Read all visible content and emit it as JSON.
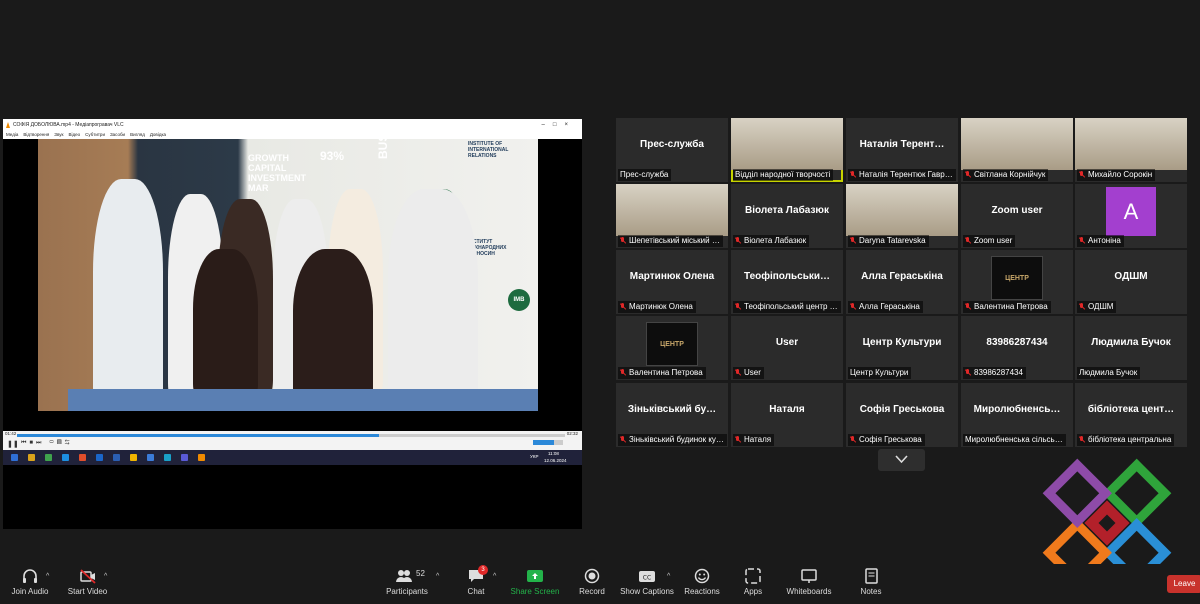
{
  "shared_screen": {
    "vlc_title": "СОФІЯ ДОБОЛЮВА.mp4 - Медіапрогравач VLC",
    "menu": [
      "Медіа",
      "Відтворення",
      "Звук",
      "Відео",
      "Субтитри",
      "Засоби",
      "Вигляд",
      "Довідка"
    ],
    "time_elapsed": "01:42",
    "time_total": "02:32",
    "progress": 0.66,
    "poster_texts": [
      "GROWTH CAPITAL INVESTMENT MAR",
      "93%",
      "BUSINESS",
      "INSTITUTE OF INTERNATIONAL RELATIONS",
      "ІНСТИТУТ МІЖНАРОДНИХ ВІДНОСИН",
      "IMB"
    ],
    "taskbar": {
      "lang": "УКР",
      "time": "11:08",
      "date": "12.06.2024"
    }
  },
  "gallery": {
    "tiles": [
      {
        "big": "Прес-служба",
        "caption": "Прес-служба",
        "muted": false,
        "video": false
      },
      {
        "big": "",
        "caption": "Відділ народної творчості",
        "muted": false,
        "video": true,
        "speaker": true
      },
      {
        "big": "Наталія Терент…",
        "caption": "Наталія Терентюк Гавр…",
        "muted": true,
        "video": false
      },
      {
        "big": "",
        "caption": "Світлана Корнійчук",
        "muted": true,
        "video": true
      },
      {
        "big": "",
        "caption": "Михайло Сорокін",
        "muted": true,
        "video": true
      },
      {
        "big": "",
        "caption": "Шепетівський міський …",
        "muted": true,
        "video": true
      },
      {
        "big": "Віолета Лабазюк",
        "caption": "Віолета Лабазюк",
        "muted": true,
        "video": false
      },
      {
        "big": "",
        "caption": "Daryna Tatarevska",
        "muted": true,
        "video": true
      },
      {
        "big": "Zoom user",
        "caption": "Zoom user",
        "muted": true,
        "video": false
      },
      {
        "big": "A",
        "caption": "Антоніна",
        "muted": true,
        "video": false,
        "avatar": true
      },
      {
        "big": "Мартинюк Олена",
        "caption": "Мартинюк Олена",
        "muted": true,
        "video": false
      },
      {
        "big": "Теофіпольськи…",
        "caption": "Теофіпольський центр …",
        "muted": true,
        "video": false
      },
      {
        "big": "Алла Гераськіна",
        "caption": "Алла Гераськіна",
        "muted": true,
        "video": false
      },
      {
        "big": "",
        "caption": "Валентина Петрова",
        "muted": true,
        "video": false,
        "image": true
      },
      {
        "big": "ОДШМ",
        "caption": "ОДШМ",
        "muted": true,
        "video": false
      },
      {
        "big": "",
        "caption": "Валентина Петрова",
        "muted": true,
        "video": false,
        "image": true
      },
      {
        "big": "User",
        "caption": "User",
        "muted": true,
        "video": false
      },
      {
        "big": "Центр Культури",
        "caption": "Центр Культури",
        "muted": false,
        "video": false
      },
      {
        "big": "83986287434",
        "caption": "83986287434",
        "muted": true,
        "video": false
      },
      {
        "big": "Людмила Бучок",
        "caption": "Людмила Бучок",
        "muted": false,
        "video": false
      },
      {
        "big": "Зіньківський бу…",
        "caption": "Зіньківський будинок ку…",
        "muted": true,
        "video": false
      },
      {
        "big": "Наталя",
        "caption": "Наталя",
        "muted": true,
        "video": false
      },
      {
        "big": "Софія Греськова",
        "caption": "Софія Греськова",
        "muted": true,
        "video": false
      },
      {
        "big": "Миролюбненсь…",
        "caption": "Миролюбненська сільсь…",
        "muted": false,
        "video": false
      },
      {
        "big": "бібліотека цент…",
        "caption": "бібліотека центральна",
        "muted": true,
        "video": false
      }
    ],
    "image_tile_text": "ЦЕНТР"
  },
  "toolbar": {
    "join_audio": "Join Audio",
    "start_video": "Start Video",
    "participants": "Participants",
    "participants_count": "52",
    "chat": "Chat",
    "chat_badge": "3",
    "share_screen": "Share Screen",
    "record": "Record",
    "show_captions": "Show Captions",
    "reactions": "Reactions",
    "apps": "Apps",
    "whiteboards": "Whiteboards",
    "notes": "Notes",
    "leave": "Leave"
  },
  "colors": {
    "accent_green": "#23b34a",
    "leave_red": "#c8322c",
    "speaker_outline": "#c7d400",
    "avatar_purple": "#a33fcf"
  }
}
